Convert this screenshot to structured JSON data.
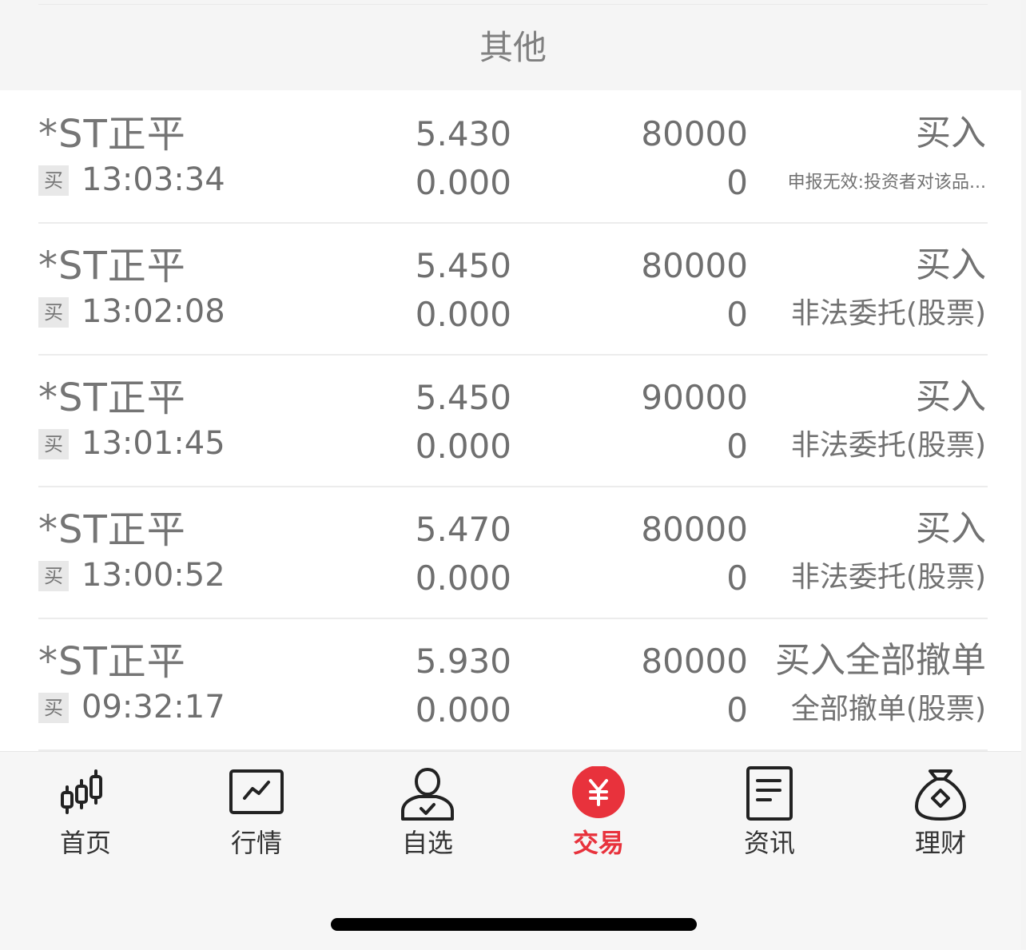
{
  "header": {
    "title": "其他"
  },
  "orders": [
    {
      "name": "*ST正平",
      "tag": "买",
      "time": "13:03:34",
      "price": "5.430",
      "filled_price": "0.000",
      "quantity": "80000",
      "filled_quantity": "0",
      "action": "买入",
      "status": "申报无效:投资者对该品..."
    },
    {
      "name": "*ST正平",
      "tag": "买",
      "time": "13:02:08",
      "price": "5.450",
      "filled_price": "0.000",
      "quantity": "80000",
      "filled_quantity": "0",
      "action": "买入",
      "status": "非法委托(股票)"
    },
    {
      "name": "*ST正平",
      "tag": "买",
      "time": "13:01:45",
      "price": "5.450",
      "filled_price": "0.000",
      "quantity": "90000",
      "filled_quantity": "0",
      "action": "买入",
      "status": "非法委托(股票)"
    },
    {
      "name": "*ST正平",
      "tag": "买",
      "time": "13:00:52",
      "price": "5.470",
      "filled_price": "0.000",
      "quantity": "80000",
      "filled_quantity": "0",
      "action": "买入",
      "status": "非法委托(股票)"
    },
    {
      "name": "*ST正平",
      "tag": "买",
      "time": "09:32:17",
      "price": "5.930",
      "filled_price": "0.000",
      "quantity": "80000",
      "filled_quantity": "0",
      "action": "买入全部撤单",
      "status": "全部撤单(股票)"
    }
  ],
  "tabbar": {
    "active_color": "#e8323c",
    "items": [
      {
        "label": "首页",
        "icon": "candlestick-icon"
      },
      {
        "label": "行情",
        "icon": "market-chart-icon"
      },
      {
        "label": "自选",
        "icon": "user-check-icon"
      },
      {
        "label": "交易",
        "icon": "yen-trade-icon",
        "active": true
      },
      {
        "label": "资讯",
        "icon": "news-document-icon"
      },
      {
        "label": "理财",
        "icon": "money-bag-icon"
      }
    ]
  }
}
